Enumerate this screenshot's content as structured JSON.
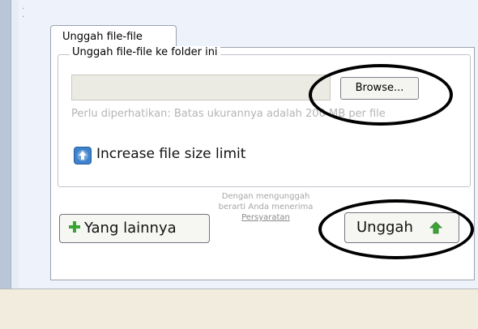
{
  "tab": {
    "label": "Unggah file-file"
  },
  "fieldset": {
    "legend": "Unggah file-file ke folder ini"
  },
  "file_input": {
    "value": ""
  },
  "browse_button": {
    "label": "Browse..."
  },
  "note": {
    "text": "Perlu diperhatikan: Batas ukurannya adalah 200 MB per file"
  },
  "increase_limit": {
    "label": "Increase file size limit"
  },
  "more_button": {
    "label": "Yang lainnya"
  },
  "terms": {
    "text": "Dengan mengunggah berarti Anda menerima",
    "link": "Persyaratan"
  },
  "upload_button": {
    "label": "Unggah"
  },
  "colors": {
    "accent": "#3d82cc",
    "plus": "#3aa536",
    "annotation_ring": "#000000"
  }
}
